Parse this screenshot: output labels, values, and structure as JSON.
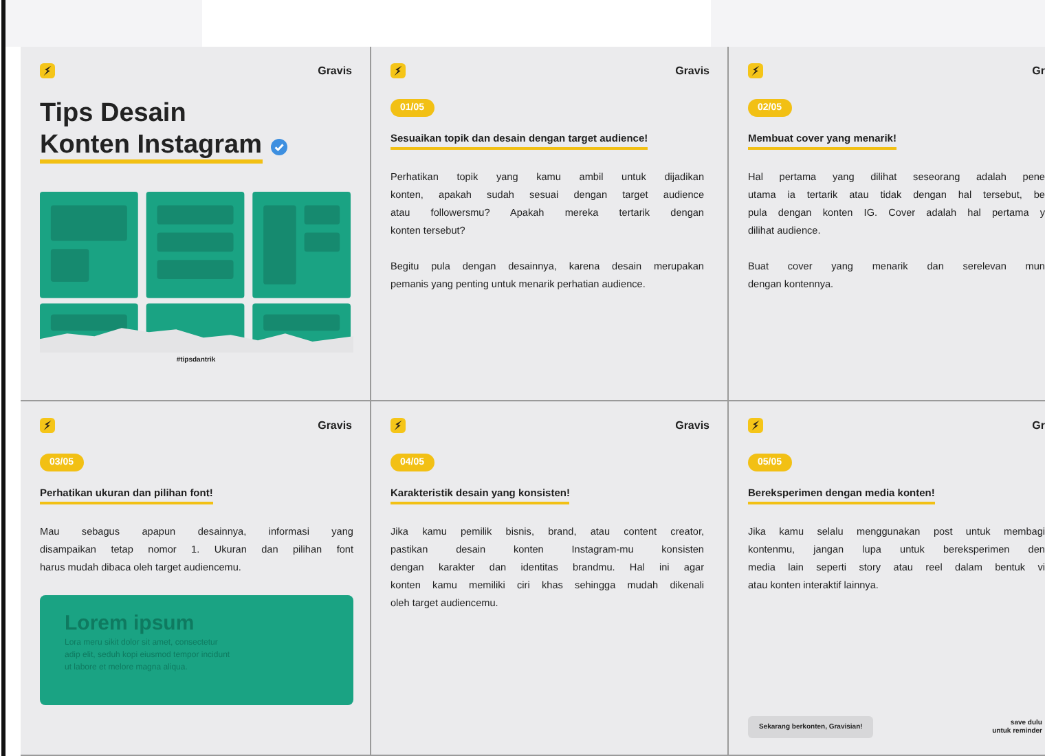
{
  "slides": [
    {
      "kind": "cover",
      "brand": "Gravis",
      "title_lines": [
        "Tips Desain",
        "Konten Instagram"
      ],
      "hashtag": "#tipsdantrik"
    },
    {
      "kind": "tip",
      "brand": "Gravis",
      "number": "01/05",
      "heading": "Sesuaikan topik dan desain dengan target audience!",
      "paragraphs": [
        [
          "Perhatikan topik yang kamu ambil untuk dijadikan",
          "konten, apakah sudah sesuai dengan target audience",
          "atau followersmu? Apakah mereka tertarik dengan",
          "konten tersebut?"
        ],
        [
          "Begitu pula dengan desainnya, karena desain merupakan",
          "pemanis yang penting untuk menarik perhatian audience."
        ]
      ]
    },
    {
      "kind": "tip",
      "brand": "Gr",
      "number": "02/05",
      "heading": "Membuat cover yang menarik!",
      "paragraphs": [
        [
          "Hal pertama yang dilihat seseorang adalah pene",
          "utama ia tertarik atau tidak dengan hal tersebut, be",
          "pula dengan konten IG. Cover adalah hal pertama y",
          "dilihat audience."
        ],
        [
          "Buat cover yang menarik dan serelevan mun",
          "dengan kontennya."
        ]
      ]
    },
    {
      "kind": "tip",
      "brand": "Gravis",
      "number": "03/05",
      "heading": "Perhatikan ukuran dan pilihan font!",
      "paragraphs": [
        [
          "Mau sebagus apapun desainnya, informasi yang",
          "disampaikan tetap nomor 1. Ukuran dan pilihan font",
          "harus mudah dibaca oleh target audiencemu."
        ]
      ],
      "card": {
        "title": "Lorem ipsum",
        "lines": [
          "Lora meru sikit dolor sit amet, consectetur",
          "adip elit, seduh kopi eiusmod tempor incidunt",
          "ut labore et melore magna aliqua."
        ]
      }
    },
    {
      "kind": "tip",
      "brand": "Gravis",
      "number": "04/05",
      "heading": "Karakteristik desain yang konsisten!",
      "paragraphs": [
        [
          "Jika kamu pemilik bisnis, brand, atau content creator,",
          "pastikan desain konten Instagram-mu konsisten",
          "dengan karakter dan identitas brandmu. Hal ini agar",
          "konten kamu memiliki ciri khas sehingga mudah dikenali",
          "oleh target audiencemu."
        ]
      ]
    },
    {
      "kind": "tip",
      "brand": "Gr",
      "number": "05/05",
      "heading": "Bereksperimen dengan media konten!",
      "paragraphs": [
        [
          "Jika kamu selalu menggunakan post untuk membagi",
          "kontenmu, jangan lupa untuk bereksperimen den",
          "media lain seperti story atau reel dalam bentuk vi",
          "atau konten interaktif lainnya."
        ]
      ],
      "footer": {
        "note": "Sekarang berkonten, Gravisian!",
        "reminder_lines": [
          "save dulu",
          "untuk reminder"
        ]
      }
    }
  ]
}
